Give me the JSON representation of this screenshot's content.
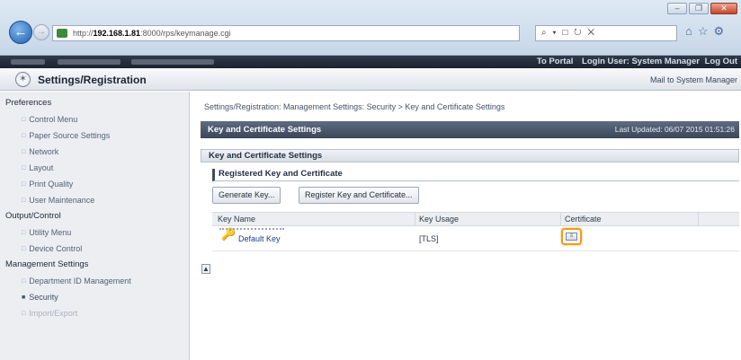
{
  "browser": {
    "address": {
      "prefix": "http://",
      "host": "192.168.1.81",
      "path": ":8000/rps/keymanage.cgi"
    },
    "search_glyphs": "⌕ ▾ □ ↻ ✕",
    "icons": {
      "home": "⌂",
      "star": "☆",
      "gear": "⚙"
    },
    "window_buttons": {
      "minimize": "–",
      "restore": "❐",
      "close": "✕"
    }
  },
  "topbar": {
    "to_portal": "To Portal",
    "login_user": "Login User: System Manager",
    "logout": "Log Out"
  },
  "header": {
    "title": "Settings/Registration",
    "mail_link": "Mail to System Manager"
  },
  "sidebar": {
    "groups": [
      {
        "label": "Preferences",
        "items": [
          "Control Menu",
          "Paper Source Settings",
          "Network",
          "Layout",
          "Print Quality",
          "User Maintenance"
        ]
      },
      {
        "label": "Output/Control",
        "items": [
          "Utility Menu",
          "Device Control"
        ]
      },
      {
        "label": "Management Settings",
        "items": [
          "Department ID Management",
          "Security",
          "Import/Export"
        ]
      }
    ]
  },
  "main": {
    "breadcrumb": "Settings/Registration: Management Settings: Security > Key and Certificate Settings",
    "page_title": "Key and Certificate Settings",
    "last_updated": "Last Updated: 06/07 2015 01:51:26",
    "section_title": "Key and Certificate Settings",
    "subsection_title": "Registered Key and Certificate",
    "buttons": {
      "generate": "Generate Key...",
      "register": "Register Key and Certificate..."
    },
    "table": {
      "headers": [
        "Key Name",
        "Key Usage",
        "Certificate"
      ],
      "rows": [
        {
          "key_name": "Default Key",
          "key_usage": "[TLS]"
        }
      ]
    },
    "top_link": "▲"
  },
  "colors": {
    "highlight": "#f39a1b",
    "header_bar": "#3a4659",
    "link": "#1b3f88"
  }
}
